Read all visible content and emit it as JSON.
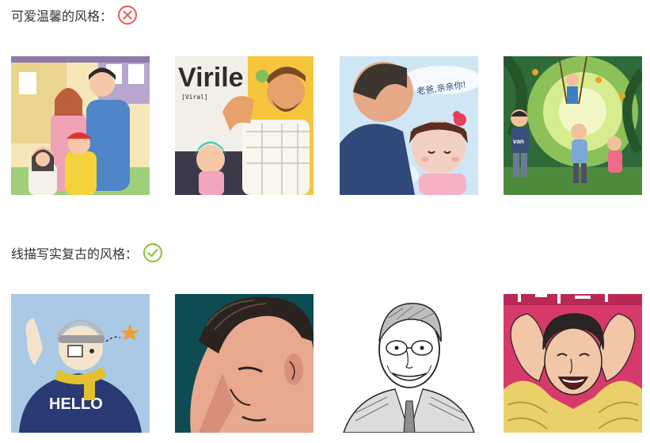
{
  "sections": [
    {
      "title": "可爱温馨的风格：",
      "status_icon": "cross-circle-icon",
      "status_color": "#e8655f",
      "images": [
        {
          "name": "family-illustration"
        },
        {
          "name": "virile-poster-illustration",
          "text": "Virile",
          "subtext": "[Viral]"
        },
        {
          "name": "father-daughter-hug-illustration",
          "text": "老爸,亲亲你!"
        },
        {
          "name": "playground-swing-illustration",
          "text": "van"
        }
      ]
    },
    {
      "title": "线描写实复古的风格：",
      "status_icon": "check-circle-icon",
      "status_color": "#8cc63f",
      "images": [
        {
          "name": "hello-sweater-illustration",
          "text": "HELLO"
        },
        {
          "name": "man-profile-teal-illustration"
        },
        {
          "name": "sketch-portrait-illustration"
        },
        {
          "name": "laughing-man-red-poster-illustration"
        }
      ]
    }
  ]
}
